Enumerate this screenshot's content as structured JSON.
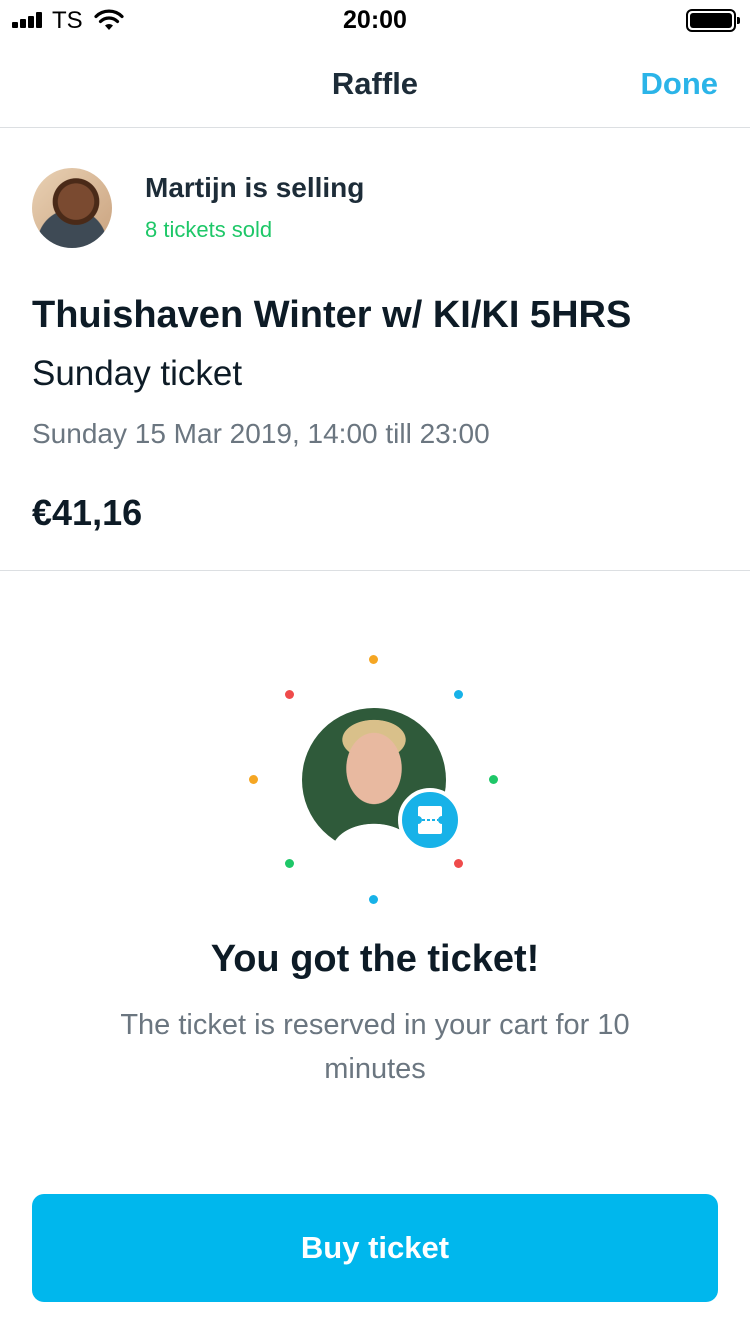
{
  "status_bar": {
    "carrier": "TS",
    "time": "20:00"
  },
  "nav": {
    "title": "Raffle",
    "done_label": "Done"
  },
  "seller": {
    "name_line": "Martijn is selling",
    "sold_line": "8 tickets sold"
  },
  "event": {
    "title": "Thuishaven Winter w/ KI/KI 5HRS",
    "subtitle": "Sunday ticket",
    "datetime": "Sunday 15 Mar 2019, 14:00 till 23:00",
    "price": "€41,16"
  },
  "result": {
    "title": "You got the ticket!",
    "message": "The ticket is reserved in your cart for 10 minutes"
  },
  "actions": {
    "buy_label": "Buy ticket"
  },
  "colors": {
    "accent": "#00b7ed",
    "done": "#2bb4e8",
    "sold_green": "#1ec768",
    "confetti": [
      "#f5a623",
      "#ef4b4b",
      "#1ec768",
      "#17b2e8"
    ]
  },
  "icons": [
    "signal-icon",
    "wifi-icon",
    "battery-icon",
    "ticket-icon"
  ]
}
